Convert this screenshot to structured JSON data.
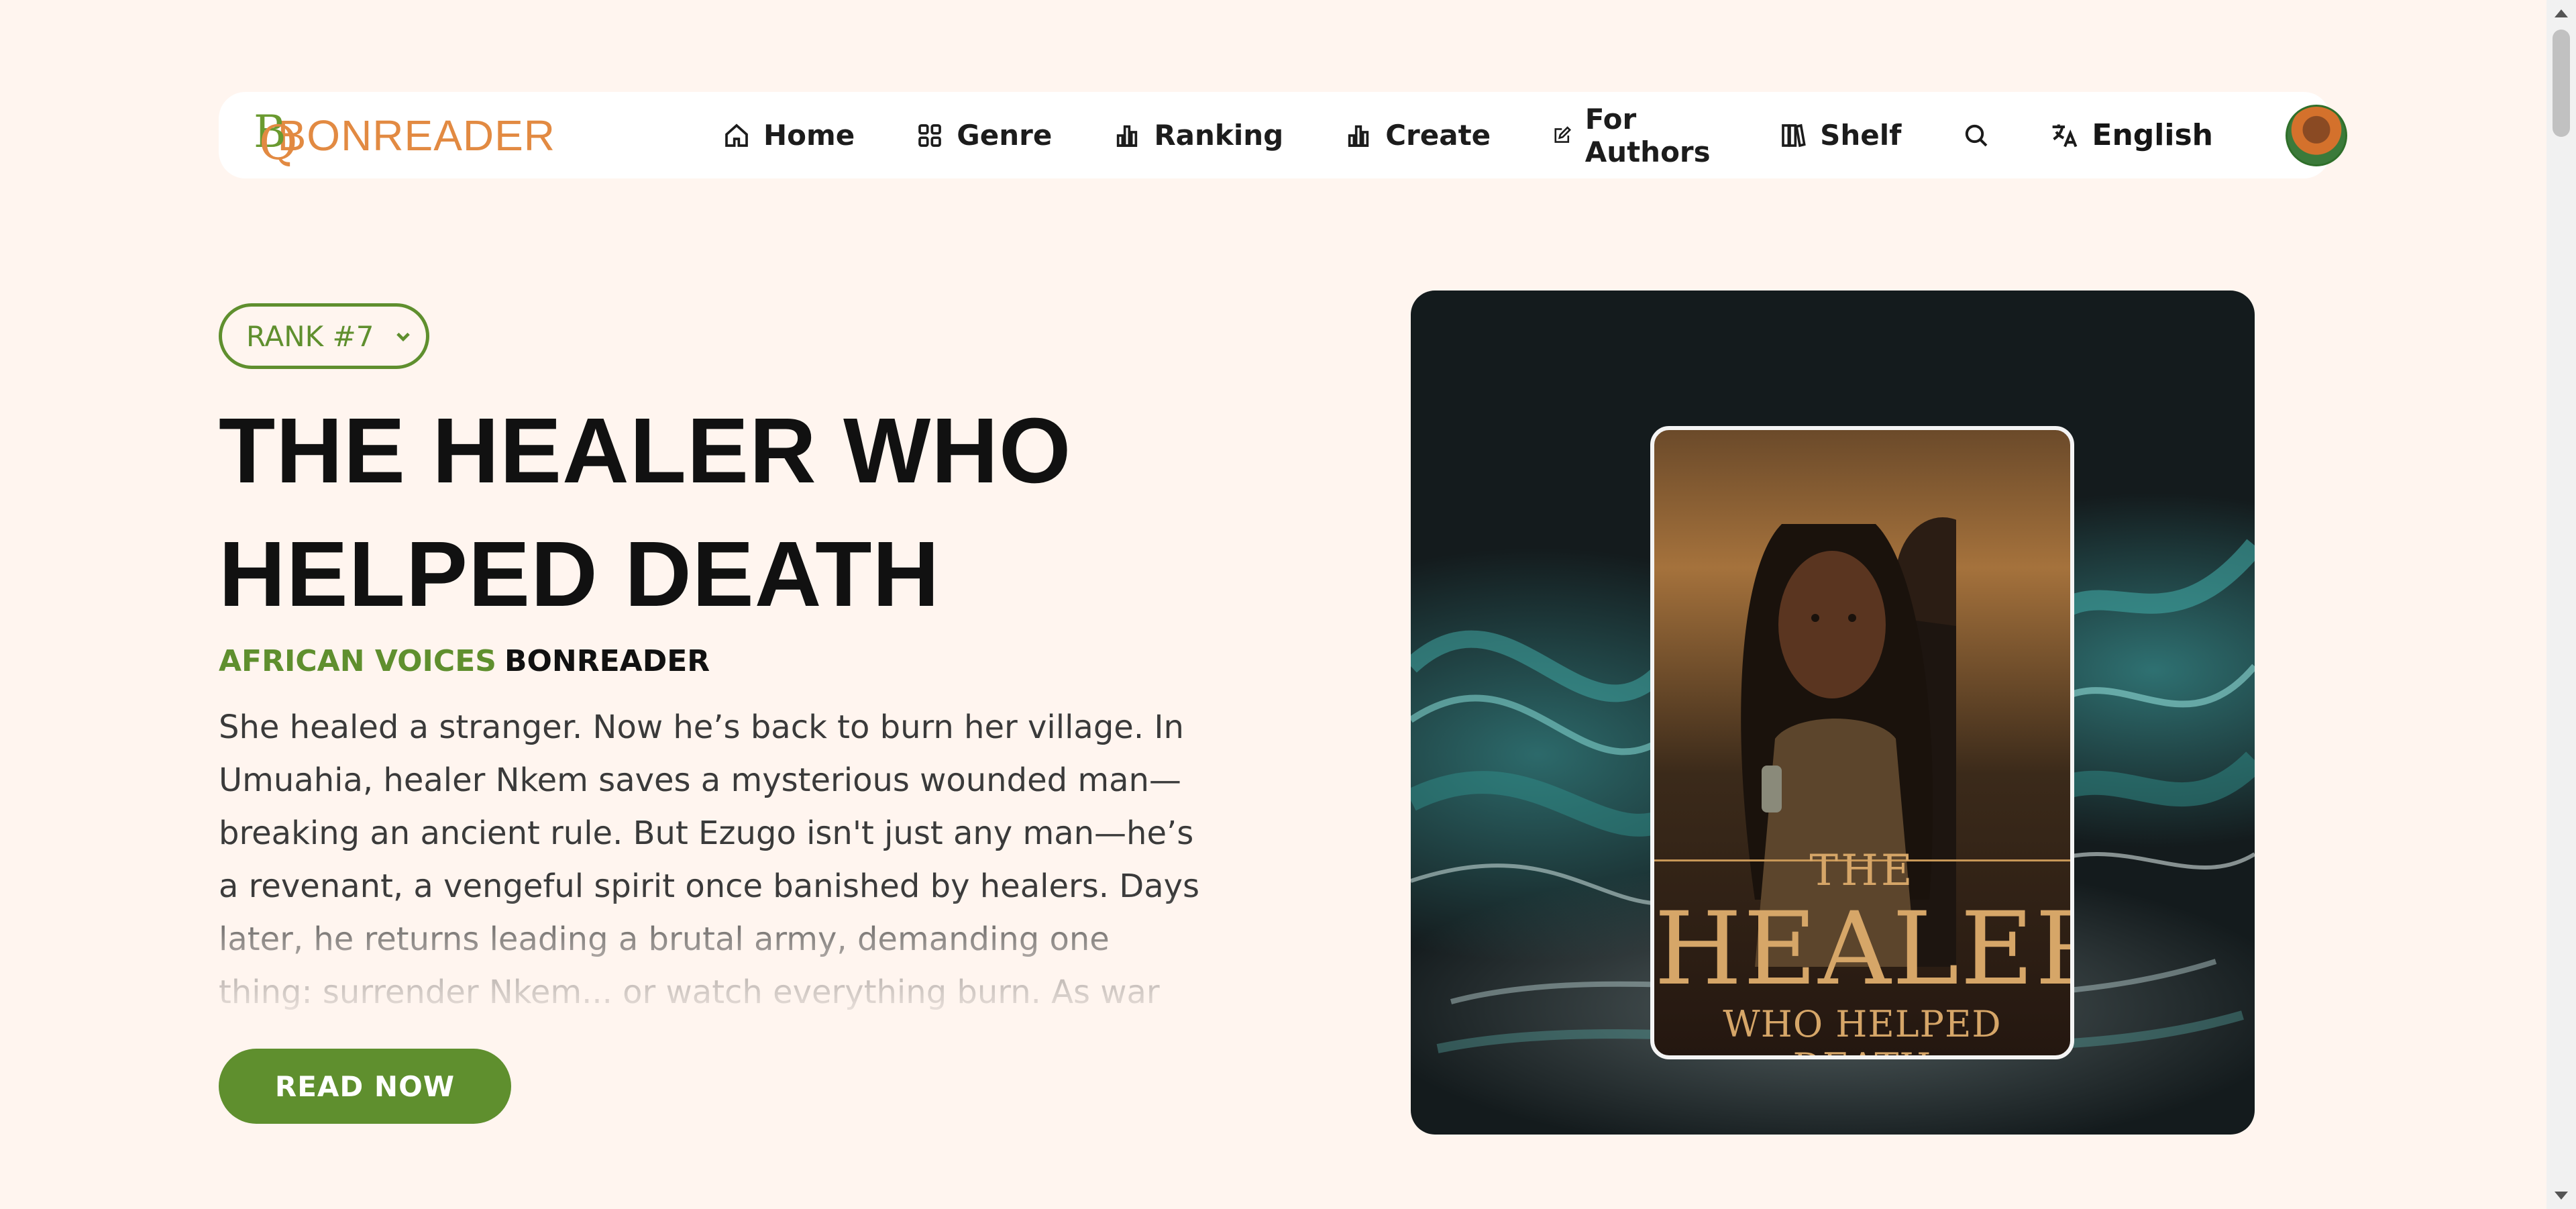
{
  "brand": {
    "name": "BONREADER",
    "accent_green": "#5f8f2e",
    "accent_orange": "#e28a42"
  },
  "nav": {
    "items": [
      {
        "label": "Home",
        "icon": "home-icon"
      },
      {
        "label": "Genre",
        "icon": "grid-icon"
      },
      {
        "label": "Ranking",
        "icon": "bar-chart-icon"
      },
      {
        "label": "Create",
        "icon": "bar-chart-icon"
      },
      {
        "label": "For Authors",
        "icon": "edit-icon"
      },
      {
        "label": "Shelf",
        "icon": "books-icon"
      }
    ],
    "search_icon": "search-icon",
    "language": {
      "label": "English",
      "icon": "translate-icon"
    }
  },
  "hero": {
    "rank": "RANK #7",
    "title": "THE HEALER WHO HELPED DEATH",
    "genre": "AFRICAN VOICES",
    "publisher": "BONREADER",
    "synopsis": "She healed a stranger. Now he’s back to burn her village. In Umuahia, healer Nkem saves a mysterious wounded man—breaking an ancient rule. But Ezugo isn't just any man—he’s a revenant, a vengeful spirit once banished by healers. Days later, he returns leading a brutal army, demanding one thing: surrender Nkem... or watch everything burn. As war erupts and secrets unravel, Nkem",
    "cta": "READ NOW",
    "cover": {
      "line1": "THE",
      "line2": "HEALER",
      "line3": "WHO HELPED DEATH"
    }
  }
}
